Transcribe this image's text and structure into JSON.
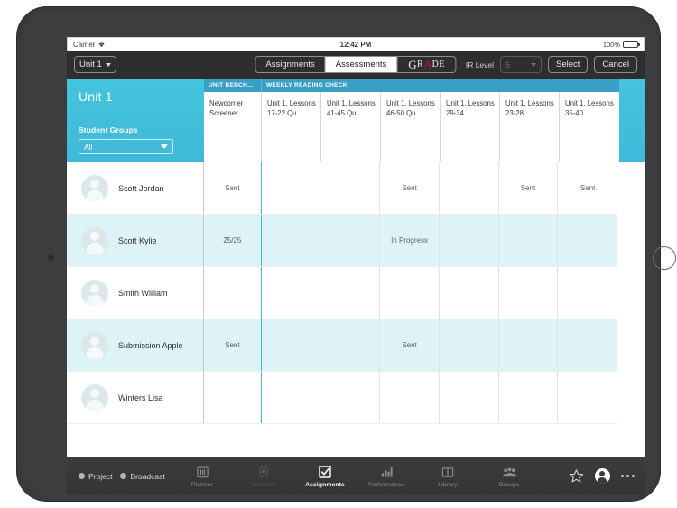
{
  "status_bar": {
    "carrier": "Carrier",
    "wifi_icon": "wifi-icon",
    "clock": "12:42 PM",
    "battery_percent": "100%"
  },
  "toolbar": {
    "unit_dropdown": "Unit 1",
    "segments": [
      {
        "label": "Assignments",
        "active": false
      },
      {
        "label": "Assessments",
        "active": true
      }
    ],
    "grade_logo": {
      "g": "G",
      "r": "R",
      "a": "A",
      "de": "DE",
      "accent_color": "#c0132b"
    },
    "ir_level_label": "IR Level",
    "ir_level_value": "5",
    "select_label": "Select",
    "cancel_label": "Cancel"
  },
  "blue_header": {
    "unit_title": "Unit 1",
    "student_groups_label": "Student Groups",
    "student_groups_value": "All",
    "accent_color": "#3fb9d8",
    "group_headers": [
      {
        "label": "UNIT BENCH...",
        "span": 1
      },
      {
        "label": "WEEKLY READING CHECK",
        "span": 6
      }
    ],
    "columns": [
      "Newcomer Screener",
      "Unit 1, Lessons 17-22 Qu...",
      "Unit 1, Lessons 41-45 Qu...",
      "Unit 1, Lessons 46-50 Qu...",
      "Unit 1, Lessons 29-34",
      "Unit 1, Lessons 23-28",
      "Unit 1, Lessons 35-40"
    ]
  },
  "table": {
    "rows": [
      {
        "name": "Scott Jordan",
        "alt": false,
        "cells": [
          "Sent",
          "",
          "",
          "Sent",
          "",
          "Sent",
          "Sent"
        ]
      },
      {
        "name": "Scott Kylie",
        "alt": true,
        "cells": [
          "25/25",
          "",
          "",
          "In Progress",
          "",
          "",
          ""
        ]
      },
      {
        "name": "Smith William",
        "alt": false,
        "cells": [
          "",
          "",
          "",
          "",
          "",
          "",
          ""
        ]
      },
      {
        "name": "Submission Apple",
        "alt": true,
        "cells": [
          "Sent",
          "",
          "",
          "Sent",
          "",
          "",
          ""
        ]
      },
      {
        "name": "Winters Lisa",
        "alt": false,
        "cells": [
          "",
          "",
          "",
          "",
          "",
          "",
          ""
        ]
      }
    ]
  },
  "tabbar": {
    "radios": [
      {
        "label": "Project"
      },
      {
        "label": "Broadcast"
      }
    ],
    "tabs": [
      {
        "label": "Planner",
        "icon": "planner-icon",
        "state": "normal"
      },
      {
        "label": "Lessons",
        "icon": "lessons-icon",
        "state": "dim"
      },
      {
        "label": "Assignments",
        "icon": "assignments-icon",
        "state": "active"
      },
      {
        "label": "Performance",
        "icon": "performance-icon",
        "state": "normal"
      },
      {
        "label": "Library",
        "icon": "library-icon",
        "state": "normal"
      },
      {
        "label": "Groups",
        "icon": "groups-icon",
        "state": "normal"
      }
    ],
    "right_icons": [
      "star-icon",
      "account-avatar-icon",
      "more-icon"
    ]
  }
}
